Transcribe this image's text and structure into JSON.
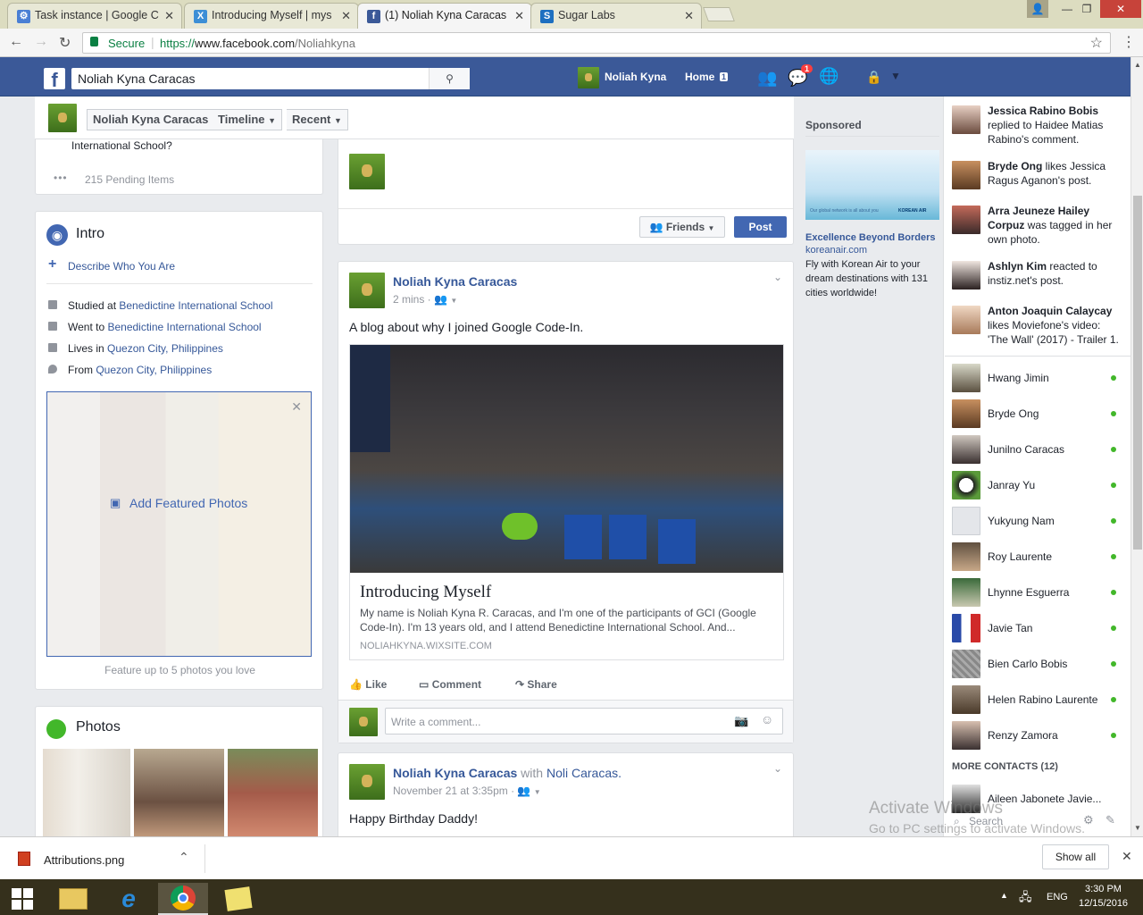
{
  "browser": {
    "tabs": [
      {
        "label": "Task instance | Google C",
        "icon": "gear-icon",
        "color": "#4a7fd4"
      },
      {
        "label": "Introducing Myself | mys",
        "icon": "wix-icon",
        "color": "#3d8fd6"
      },
      {
        "label": "(1) Noliah Kyna Caracas",
        "icon": "facebook-icon",
        "color": "#3b5998"
      },
      {
        "label": "Sugar Labs",
        "icon": "sugar-icon",
        "color": "#1d6fc0"
      }
    ],
    "secure_label": "Secure",
    "url_prefix": "https://",
    "url_domain": "www.facebook.com",
    "url_path": "/Noliahkyna"
  },
  "header": {
    "search_value": "Noliah Kyna Caracas",
    "profile_name": "Noliah Kyna",
    "home_label": "Home",
    "home_count": "1",
    "messages_badge": "1"
  },
  "subnav": {
    "name": "Noliah Kyna Caracas",
    "timeline": "Timeline",
    "recent": "Recent"
  },
  "left": {
    "prev_text": "International School?",
    "pending": "215 Pending Items",
    "intro_title": "Intro",
    "describe": "Describe Who You Are",
    "rows": [
      {
        "prefix": "Studied at ",
        "link": "Benedictine International School"
      },
      {
        "prefix": "Went to ",
        "link": "Benedictine International School"
      },
      {
        "prefix": "Lives in ",
        "link": "Quezon City, Philippines"
      },
      {
        "prefix": "From ",
        "link": "Quezon City, Philippines"
      }
    ],
    "add_featured": "Add Featured Photos",
    "featured_hint": "Feature up to 5 photos you love",
    "photos_title": "Photos"
  },
  "composer": {
    "friends_label": "Friends",
    "post_label": "Post"
  },
  "post1": {
    "name": "Noliah Kyna Caracas",
    "time": "2 mins",
    "text": "A blog about why I joined Google Code-In.",
    "link_title": "Introducing Myself",
    "link_desc": "My name is Noliah Kyna R. Caracas, and I'm one of the participants of GCI (Google Code-In). I'm 13 years old, and I attend Benedictine International School. And...",
    "link_domain": "NOLIAHKYNA.WIXSITE.COM",
    "like": "Like",
    "comment": "Comment",
    "share": "Share",
    "comment_placeholder": "Write a comment..."
  },
  "post2": {
    "name": "Noliah Kyna Caracas",
    "with_text": " with ",
    "with_name": "Noli Caracas",
    "time": "November 21 at 3:35pm",
    "text": "Happy Birthday Daddy!"
  },
  "ads": {
    "sponsored": "Sponsored",
    "title": "Excellence Beyond Borders",
    "domain": "koreanair.com",
    "desc": "Fly with Korean Air to your dream destinations with 131 cities worldwide!",
    "banner_text": "Our global network is all about you",
    "banner_brand": "KOREAN AIR"
  },
  "ticker": [
    {
      "name": "Jessica Rabino Bobis",
      "rest": " replied to Haidee Matias Rabino's comment."
    },
    {
      "name": "Bryde Ong",
      "rest": " likes Jessica Ragus Aganon's post."
    },
    {
      "name": "Arra Jeuneze Hailey Corpuz",
      "rest": " was tagged in her own photo."
    },
    {
      "name": "Ashlyn Kim",
      "rest": " reacted to instiz.net's post."
    },
    {
      "name": "Anton Joaquin Calaycay",
      "rest": " likes Moviefone's video: 'The Wall' (2017) - Trailer 1."
    }
  ],
  "contacts": [
    "Hwang Jimin",
    "Bryde Ong",
    "Junilno Caracas",
    "Janray Yu",
    "Yukyung Nam",
    "Roy Laurente",
    "Lhynne Esguerra",
    "Javie Tan",
    "Bien Carlo Bobis",
    "Helen Rabino Laurente",
    "Renzy Zamora"
  ],
  "more_contacts": "MORE CONTACTS (12)",
  "more_contact_1": "Aileen Jabonete Javie...",
  "chat_search": "Search",
  "watermark": {
    "line1": "Activate Windows",
    "line2": "Go to PC settings to activate Windows."
  },
  "download": {
    "file": "Attributions.png",
    "show_all": "Show all"
  },
  "taskbar": {
    "time": "3:30 PM",
    "date": "12/15/2016",
    "lang": "ENG"
  }
}
